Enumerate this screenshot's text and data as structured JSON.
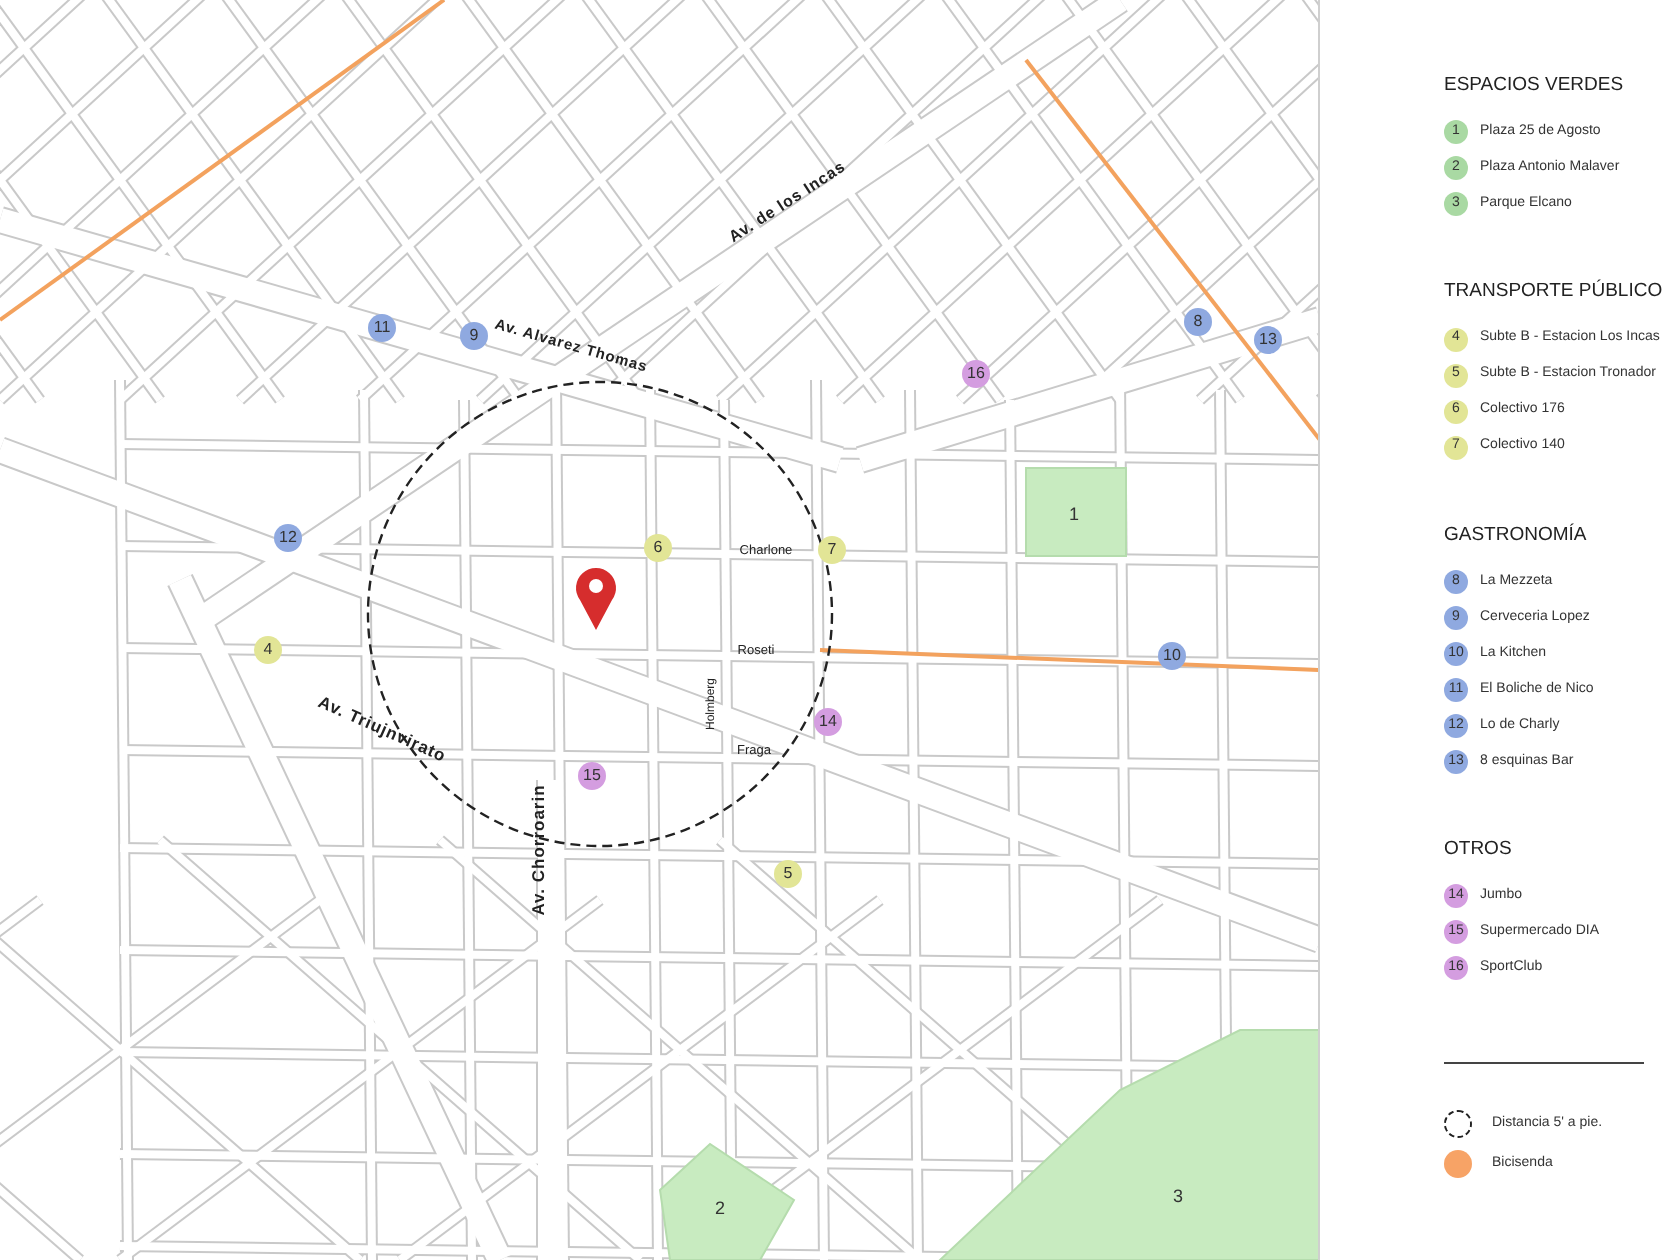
{
  "map": {
    "parks": [
      {
        "number": "1"
      },
      {
        "number": "2"
      },
      {
        "number": "3"
      }
    ],
    "markers": [
      {
        "number": "4",
        "color": "#e2e596"
      },
      {
        "number": "5",
        "color": "#e2e596"
      },
      {
        "number": "6",
        "color": "#e2e596"
      },
      {
        "number": "7",
        "color": "#e2e596"
      },
      {
        "number": "8",
        "color": "#8fa9e0"
      },
      {
        "number": "9",
        "color": "#8fa9e0"
      },
      {
        "number": "10",
        "color": "#8fa9e0"
      },
      {
        "number": "11",
        "color": "#8fa9e0"
      },
      {
        "number": "12",
        "color": "#8fa9e0"
      },
      {
        "number": "13",
        "color": "#8fa9e0"
      },
      {
        "number": "14",
        "color": "#d49de0"
      },
      {
        "number": "15",
        "color": "#d49de0"
      },
      {
        "number": "16",
        "color": "#d49de0"
      }
    ],
    "street_labels": [
      "Av. de los Incas",
      "Av. Alvarez Thomas",
      "Av. Triujnvirato",
      "Av. Chorroarin",
      "Charlone",
      "Roseti",
      "Holmberg",
      "Fraga"
    ]
  },
  "legend": {
    "sections": [
      {
        "title": "ESPACIOS VERDES",
        "items": [
          {
            "number": "1",
            "label": "Plaza 25 de Agosto",
            "color": "#a9d9a3"
          },
          {
            "number": "2",
            "label": "Plaza Antonio Malaver",
            "color": "#a9d9a3"
          },
          {
            "number": "3",
            "label": "Parque Elcano",
            "color": "#a9d9a3"
          }
        ]
      },
      {
        "title": "TRANSPORTE PÚBLICO",
        "items": [
          {
            "number": "4",
            "label": "Subte B - Estacion Los Incas",
            "color": "#e2e596"
          },
          {
            "number": "5",
            "label": "Subte B - Estacion Tronador",
            "color": "#e2e596"
          },
          {
            "number": "6",
            "label": "Colectivo 176",
            "color": "#e2e596"
          },
          {
            "number": "7",
            "label": "Colectivo 140",
            "color": "#e2e596"
          }
        ]
      },
      {
        "title": "GASTRONOMÍA",
        "items": [
          {
            "number": "8",
            "label": "La Mezzeta",
            "color": "#8fa9e0"
          },
          {
            "number": "9",
            "label": "Cerveceria Lopez",
            "color": "#8fa9e0"
          },
          {
            "number": "10",
            "label": "La Kitchen",
            "color": "#8fa9e0"
          },
          {
            "number": "11",
            "label": "El Boliche de Nico",
            "color": "#8fa9e0"
          },
          {
            "number": "12",
            "label": "Lo de Charly",
            "color": "#8fa9e0"
          },
          {
            "number": "13",
            "label": "8 esquinas Bar",
            "color": "#8fa9e0"
          }
        ]
      },
      {
        "title": "OTROS",
        "items": [
          {
            "number": "14",
            "label": "Jumbo",
            "color": "#d49de0"
          },
          {
            "number": "15",
            "label": "Supermercado DIA",
            "color": "#d49de0"
          },
          {
            "number": "16",
            "label": "SportClub",
            "color": "#d49de0"
          }
        ]
      }
    ],
    "keys": [
      {
        "kind": "walk-radius",
        "label": "Distancia 5' a pie."
      },
      {
        "kind": "bike-lane",
        "label": "Bicisenda"
      }
    ]
  }
}
